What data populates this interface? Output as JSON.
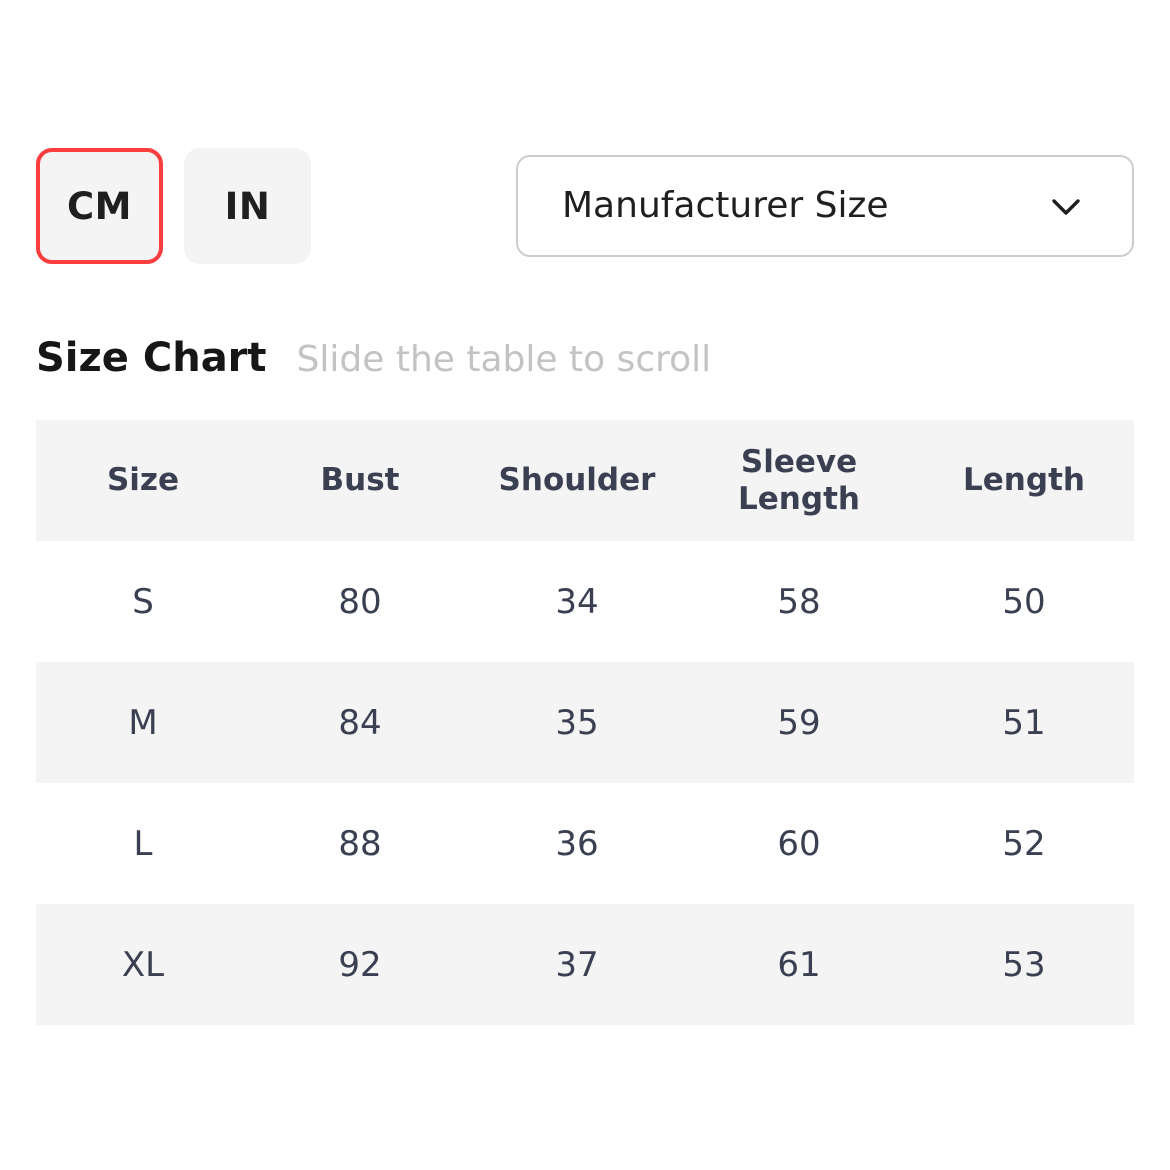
{
  "unit_toggle": {
    "selected": "CM",
    "selected_color": "#fa3e3e",
    "options": [
      {
        "label": "CM",
        "selected": true
      },
      {
        "label": "IN",
        "selected": false
      }
    ]
  },
  "size_type_select": {
    "value": "Manufacturer Size",
    "icon": "chevron-down-icon",
    "options": [
      "Manufacturer Size"
    ]
  },
  "section": {
    "title": "Size Chart",
    "hint": "Slide the table to scroll"
  },
  "table": {
    "columns": [
      "Size",
      "Bust",
      "Shoulder",
      "Sleeve Length",
      "Length"
    ],
    "rows": [
      {
        "size": "S",
        "bust": "80",
        "shoulder": "34",
        "sleeve_length": "58",
        "length": "50"
      },
      {
        "size": "M",
        "bust": "84",
        "shoulder": "35",
        "sleeve_length": "59",
        "length": "51"
      },
      {
        "size": "L",
        "bust": "88",
        "shoulder": "36",
        "sleeve_length": "60",
        "length": "52"
      },
      {
        "size": "XL",
        "bust": "92",
        "shoulder": "37",
        "sleeve_length": "61",
        "length": "53"
      }
    ]
  },
  "colors": {
    "accent": "#fa3e3e",
    "surface": "#f4f4f5",
    "text": "#3a3f51",
    "muted": "#c3c3c3"
  }
}
